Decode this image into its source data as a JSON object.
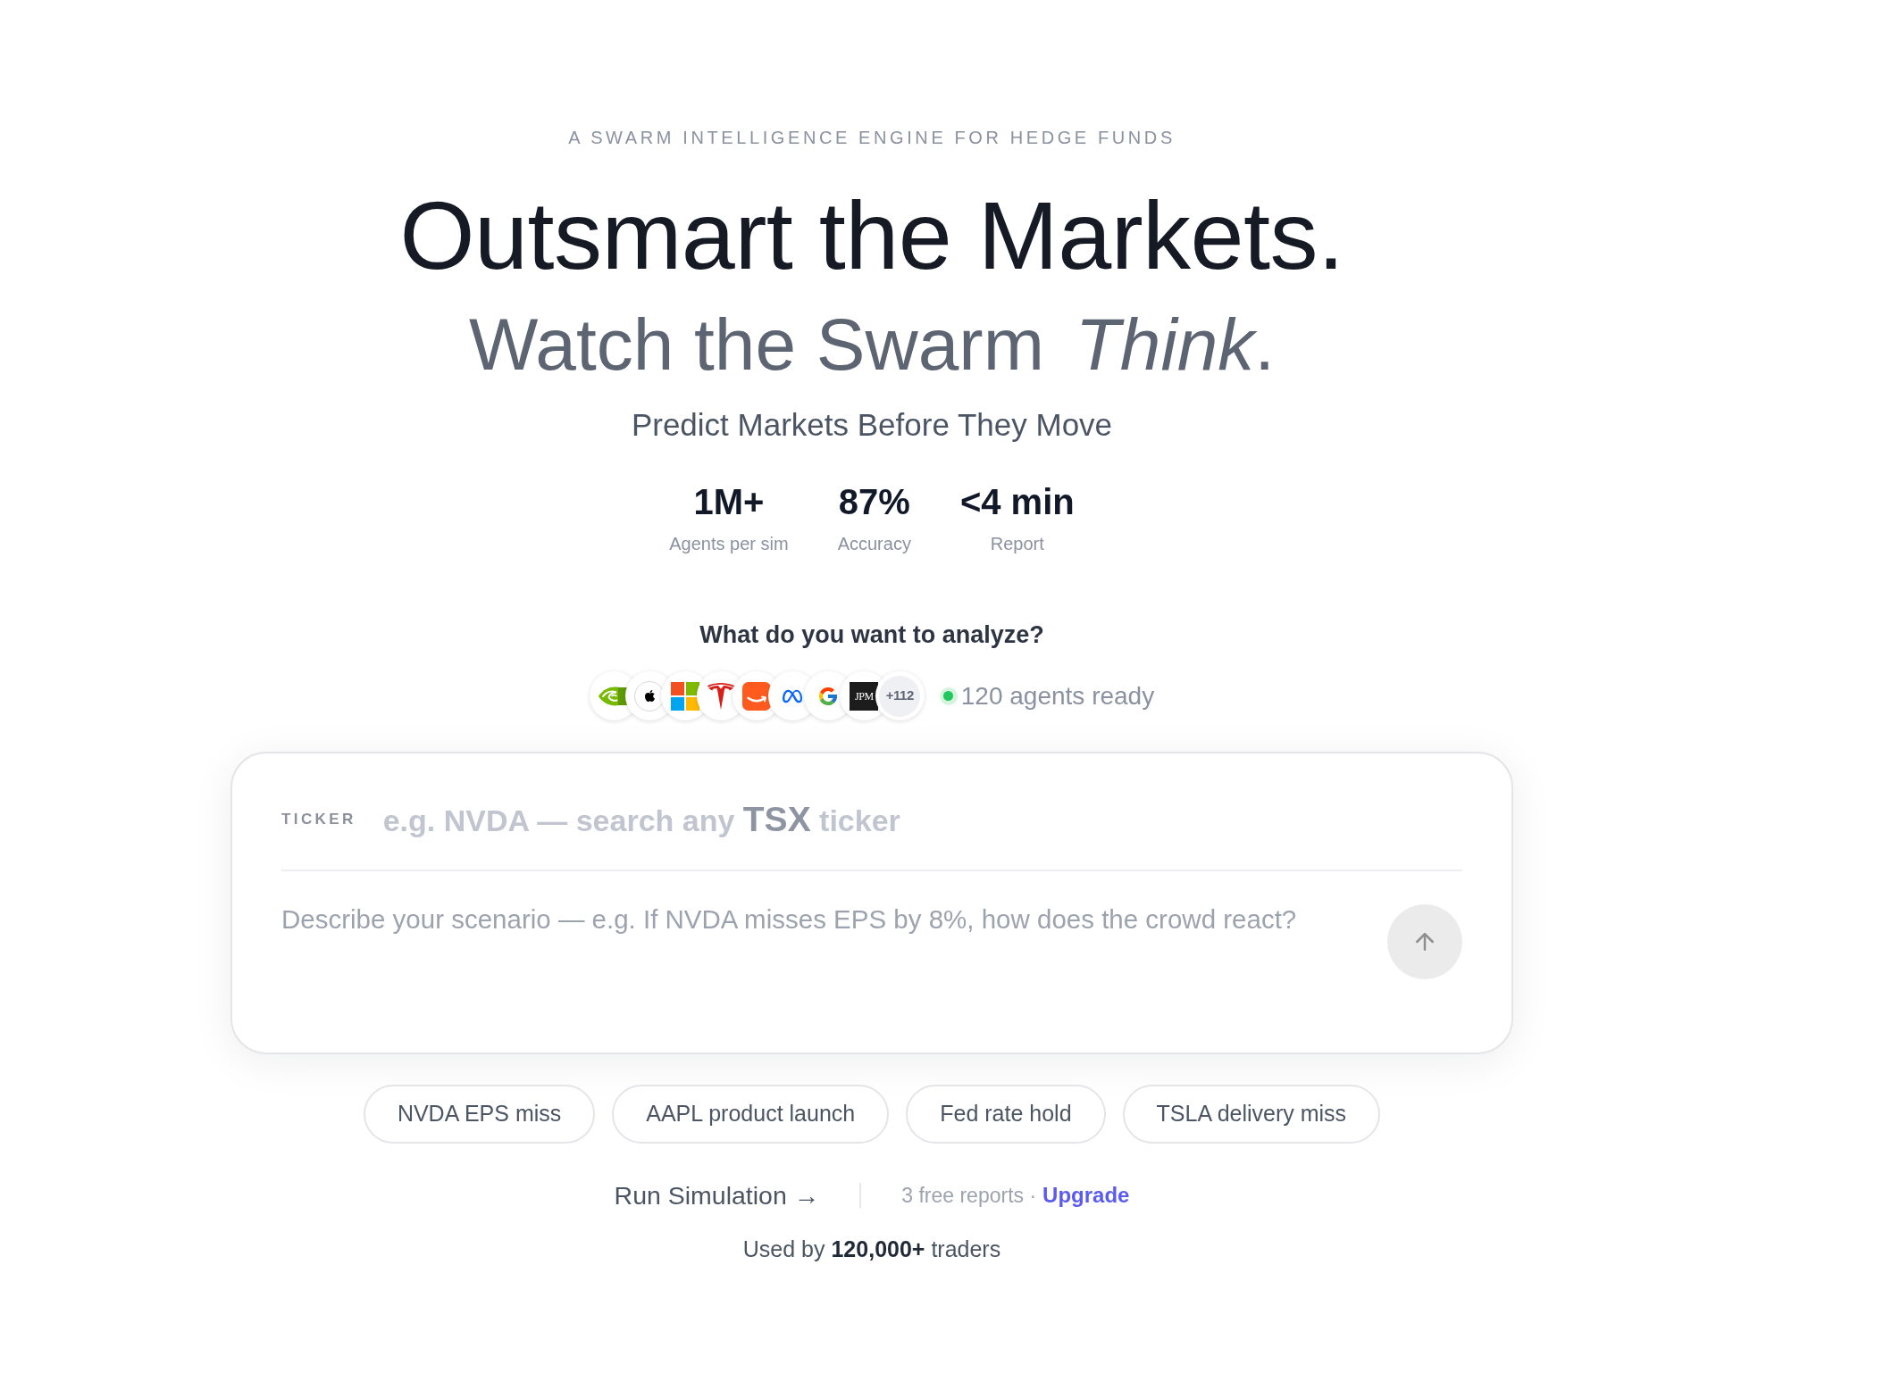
{
  "eyebrow": "A SWARM INTELLIGENCE ENGINE FOR HEDGE FUNDS",
  "headline": "Outsmart the Markets.",
  "subheadline": "Watch the Swarm *Think*.",
  "tagline": "Predict Markets Before They Move",
  "stats": [
    {
      "value": "1M+",
      "label": "Agents per sim"
    },
    {
      "value": "87%",
      "label": "Accuracy"
    },
    {
      "value": "<4 min",
      "label": "Report"
    }
  ],
  "prompt_heading": "What do you want to analyze?",
  "logos": [
    {
      "kind": "eye"
    },
    {
      "kind": "apple"
    },
    {
      "kind": "tiles"
    },
    {
      "kind": "t"
    },
    {
      "kind": "smile"
    },
    {
      "kind": "infinity"
    },
    {
      "kind": "g"
    },
    {
      "kind": "wordmark",
      "label": "JPM"
    }
  ],
  "more_logos": "+112",
  "agents_status": "120 agents ready",
  "composer": {
    "ticker_field": {
      "label": "TICKER",
      "placeholder": "e.g. NVDA — search any **TSX** ticker"
    },
    "scenario_field": {
      "placeholder": "Describe your scenario — e.g. If NVDA misses EPS by 8%, how does the crowd react?"
    },
    "send_button": {
      "disabled": true
    }
  },
  "suggestions": [
    "NVDA EPS miss",
    "AAPL product launch",
    "Fed rate hold",
    "TSLA delivery miss"
  ],
  "run_button": "Run Simulation →",
  "quota_text": "3 free reports ·",
  "upgrade_link": "Upgrade",
  "social_proof": "Used by **120,000+** traders"
}
